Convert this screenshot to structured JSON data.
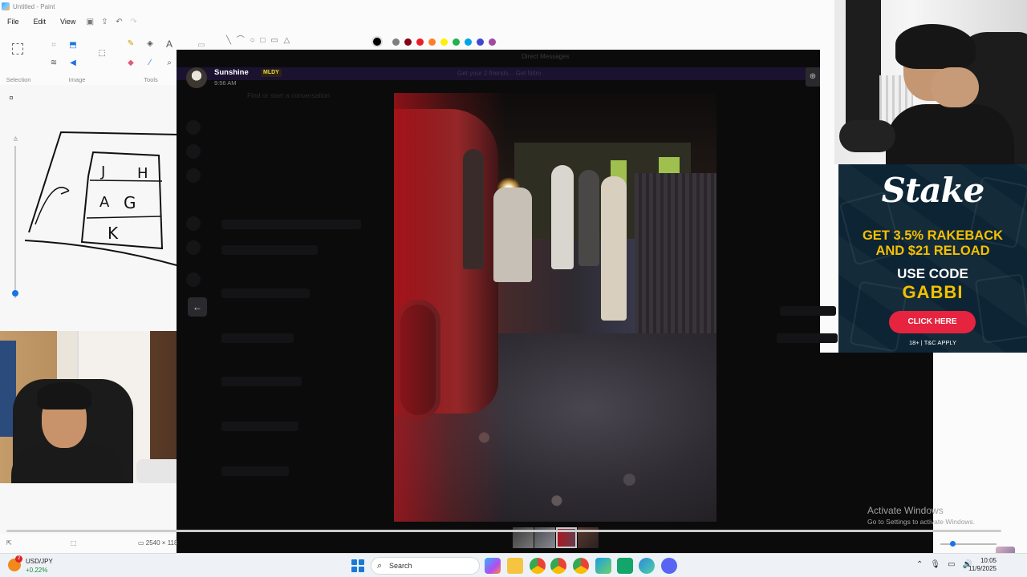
{
  "paint": {
    "window_title": "Untitled - Paint",
    "menu": [
      "File",
      "Edit",
      "View"
    ],
    "ribbon_groups": [
      "Selection",
      "Image",
      "Tools"
    ],
    "palette": [
      "#000000",
      "#7f7f7f",
      "#880015",
      "#ed1c24",
      "#ff7f27",
      "#fff200",
      "#22b14c",
      "#00a2e8",
      "#3f48cc",
      "#a349a4"
    ],
    "canvas_size": "2540 × 118",
    "drawing_letters": [
      "J",
      "H",
      "A",
      "G",
      "K"
    ]
  },
  "discord": {
    "header_text": "Direct Messages",
    "banner_text": "Get your 2 friends... Get Nitro",
    "search_placeholder": "Find or start a conversation",
    "sender": {
      "name": "Sunshine",
      "badge": "MLDY",
      "time": "9:56 AM"
    },
    "icons": {
      "zoom": "zoom-in-icon",
      "prev": "arrow-left-icon"
    },
    "attachments_count": 4,
    "active_attachment": 3
  },
  "ad": {
    "brand": "Stake",
    "promo_line1": "GET 3.5% RAKEBACK",
    "promo_line2": "AND $21 RELOAD",
    "use_code_label": "USE CODE",
    "code": "GABBI",
    "cta": "CLICK HERE",
    "disclaimer": "18+ | T&C APPLY",
    "colors": {
      "bg": "#0d2434",
      "accent": "#f5c000",
      "cta": "#e6243f"
    }
  },
  "windows": {
    "activate_title": "Activate Windows",
    "activate_sub": "Go to Settings to activate Windows."
  },
  "taskbar": {
    "ticker_symbol": "USD/JPY",
    "ticker_change": "+0.22%",
    "ticker_badge": "2",
    "search_label": "Search",
    "time": "10:05",
    "date": "11/9/2025",
    "apps": [
      "copilot",
      "file-explorer",
      "chrome",
      "chrome",
      "chrome",
      "snipping-tool",
      "media",
      "edge",
      "discord"
    ]
  }
}
